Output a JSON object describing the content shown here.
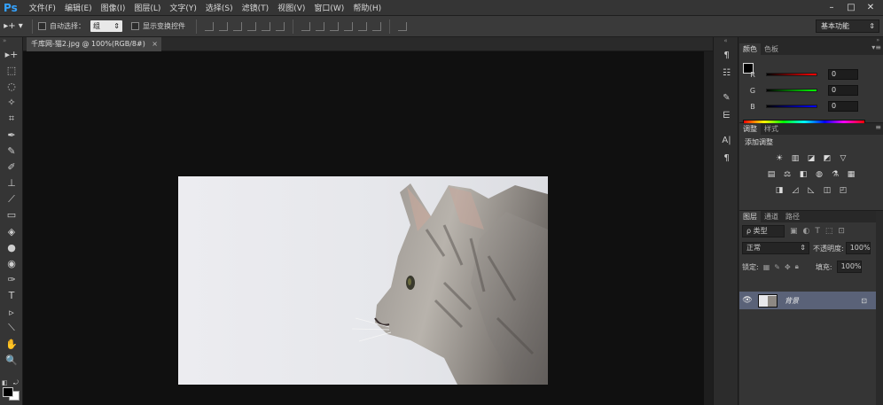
{
  "app": {
    "logo": "Ps"
  },
  "menu": [
    "文件(F)",
    "编辑(E)",
    "图像(I)",
    "图层(L)",
    "文字(Y)",
    "选择(S)",
    "滤镜(T)",
    "视图(V)",
    "窗口(W)",
    "帮助(H)"
  ],
  "window_controls": [
    "–",
    "□",
    "✕"
  ],
  "options": {
    "auto_select_label": "自动选择：",
    "auto_select_value": "组",
    "show_transform_label": "显示变换控件",
    "workspace": "基本功能"
  },
  "document_tab": {
    "title": "千库网-猫2.jpg @ 100%(RGB/8#)",
    "close": "×"
  },
  "tools": [
    "▸+",
    "⬚",
    "◌",
    "✧",
    "⌗",
    "✒",
    "✎",
    "✐",
    "⊥",
    "⟋",
    "▭",
    "◈",
    "●",
    "◉",
    "✑",
    "T",
    "▹",
    "⟍",
    "✋",
    "🔍"
  ],
  "color_panel": {
    "tabs": [
      "颜色",
      "色板"
    ],
    "channels": [
      {
        "label": "R",
        "value": "0",
        "color": "#d8272d"
      },
      {
        "label": "G",
        "value": "0",
        "color": "#2dc42d"
      },
      {
        "label": "B",
        "value": "0",
        "color": "#2727d8"
      }
    ]
  },
  "adjust_panel": {
    "tabs": [
      "调整",
      "样式"
    ],
    "add_label": "添加调整",
    "icons_row1": [
      "☀",
      "▥",
      "◪",
      "◩",
      "▽"
    ],
    "icons_row2": [
      "▤",
      "⚖",
      "◧",
      "◍",
      "⚗",
      "▦"
    ],
    "icons_row3": [
      "◨",
      "◿",
      "◺",
      "◫",
      "◰"
    ]
  },
  "layers_panel": {
    "tabs": [
      "图层",
      "通道",
      "路径"
    ],
    "kind": "ρ 类型",
    "blend_mode": "正常",
    "opacity_label": "不透明度:",
    "opacity": "100%",
    "lock_label": "锁定:",
    "fill_label": "填充:",
    "fill": "100%",
    "layer_name": "背景"
  }
}
